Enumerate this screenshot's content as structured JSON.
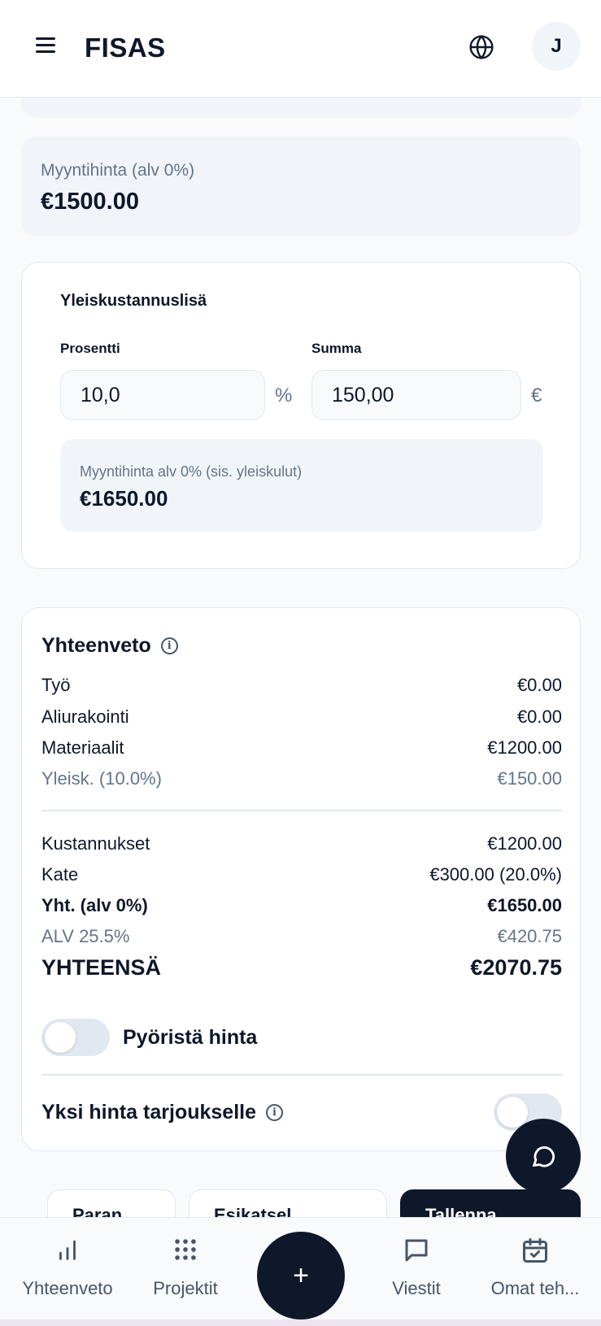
{
  "header": {
    "brand": "FISAS",
    "avatar_initial": "J"
  },
  "sales_price": {
    "label": "Myyntihinta (alv 0%)",
    "value": "€1500.00"
  },
  "overhead": {
    "title": "Yleiskustannuslisä",
    "percent_label": "Prosentti",
    "percent_value": "10,0",
    "percent_unit": "%",
    "sum_label": "Summa",
    "sum_value": "150,00",
    "sum_unit": "€",
    "total_label": "Myyntihinta alv 0% (sis. yleiskulut)",
    "total_value": "€1650.00"
  },
  "summary": {
    "title": "Yhteenveto",
    "rows": [
      {
        "label": "Työ",
        "value": "€0.00"
      },
      {
        "label": "Aliurakointi",
        "value": "€0.00"
      },
      {
        "label": "Materiaalit",
        "value": "€1200.00"
      },
      {
        "label": "Yleisk. (10.0%)",
        "value": "€150.00"
      },
      {
        "label": "Kustannukset",
        "value": "€1200.00"
      },
      {
        "label": "Kate",
        "value": "€300.00 (20.0%)"
      },
      {
        "label": "Yht. (alv 0%)",
        "value": "€1650.00"
      },
      {
        "label": "ALV 25.5%",
        "value": "€420.75"
      },
      {
        "label": "YHTEENSÄ",
        "value": "€2070.75"
      }
    ],
    "round_price_label": "Pyöristä hinta",
    "single_price_label": "Yksi hinta tarjoukselle"
  },
  "actions": {
    "btn1": "Paran",
    "btn2": "Esikatsel",
    "btn3": "Tallenna"
  },
  "bottom_nav": {
    "items": [
      "Yhteenveto",
      "Projektit",
      "Viestit",
      "Omat teh..."
    ],
    "add": "+"
  }
}
